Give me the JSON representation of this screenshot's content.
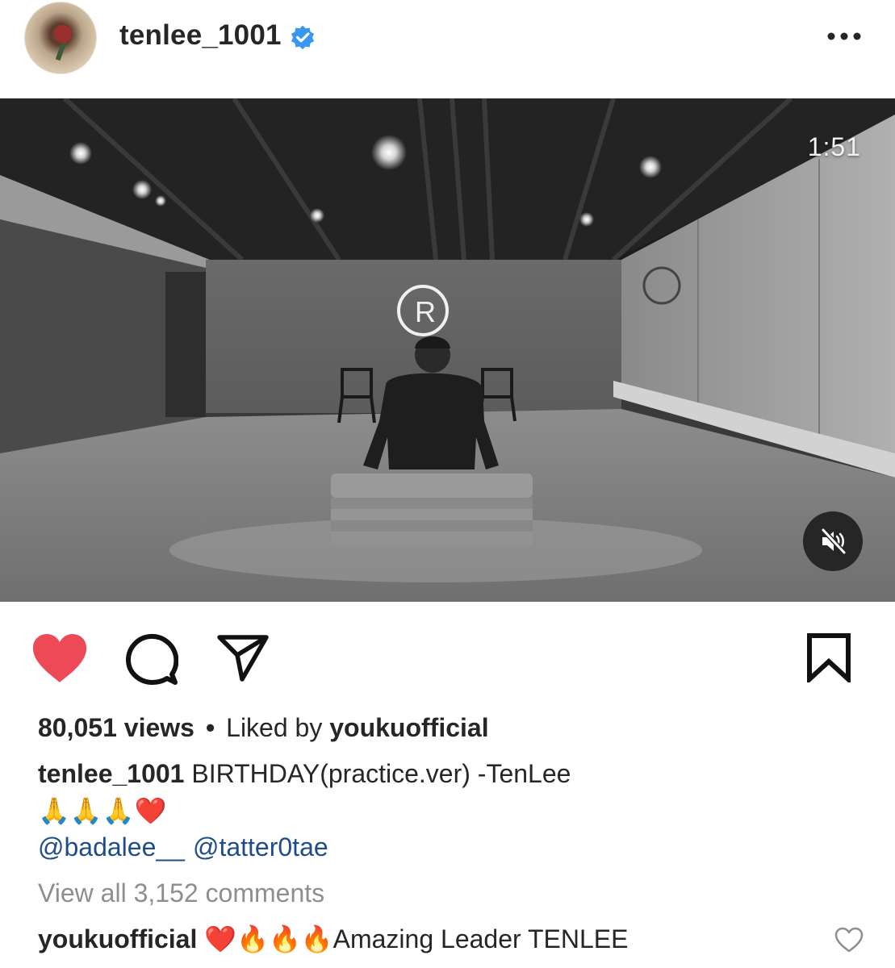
{
  "header": {
    "username": "tenlee_1001",
    "verified_icon": "verified-badge-icon",
    "more_icon": "more-options-icon"
  },
  "video": {
    "duration": "1:51",
    "mute_icon": "muted-speaker-icon",
    "grayscale": true
  },
  "actions": {
    "like_icon": "heart-filled-icon",
    "like_color": "#ed4956",
    "comment_icon": "comment-bubble-icon",
    "share_icon": "paper-plane-icon",
    "save_icon": "bookmark-icon"
  },
  "post": {
    "views": "80,051 views",
    "separator": "•",
    "liked_by_prefix": "Liked by",
    "liked_by_user": "youkuofficial",
    "caption_user": "tenlee_1001",
    "caption_text": "BIRTHDAY(practice.ver) -TenLee",
    "caption_emojis": "🙏🙏🙏❤️",
    "mentions": [
      "@badalee__",
      "@tatter0tae"
    ],
    "mention_color": "#1f4d8c",
    "view_all_comments": "View all 3,152 comments"
  },
  "comments": [
    {
      "user": "youkuofficial",
      "emojis": "❤️🔥🔥🔥",
      "text": "Amazing Leader TENLEE",
      "like_icon": "heart-outline-icon"
    }
  ]
}
